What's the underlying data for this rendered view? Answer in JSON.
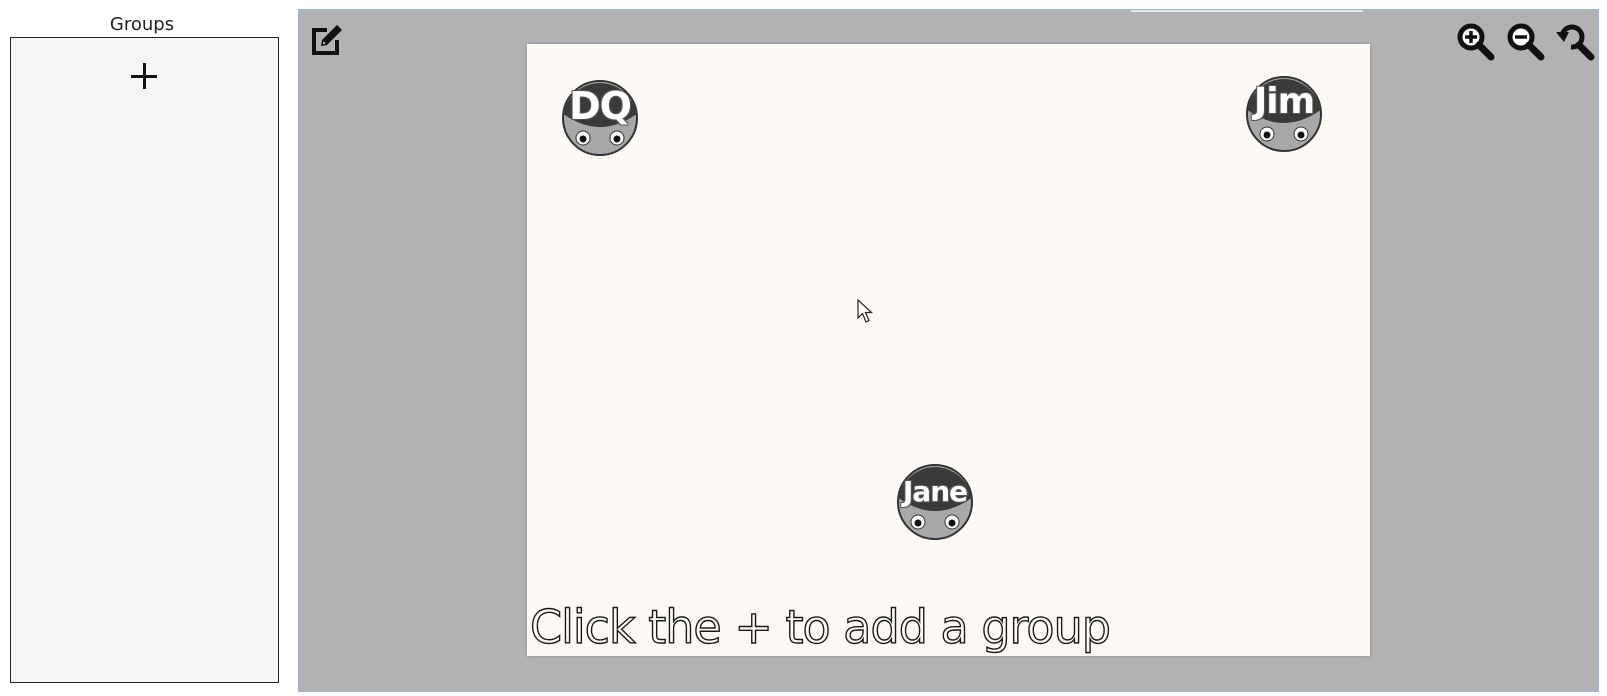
{
  "sidebar": {
    "title": "Groups",
    "add_button_icon": "plus-icon"
  },
  "toolbar": {
    "edit_icon": "edit-icon",
    "zoom_in_icon": "zoom-in-icon",
    "zoom_out_icon": "zoom-out-icon",
    "zoom_reset_icon": "zoom-reset-icon"
  },
  "canvas": {
    "members": [
      {
        "label": "DQ"
      },
      {
        "label": "Jim"
      },
      {
        "label": "Jane"
      }
    ],
    "hint": "Click the + to add a group"
  },
  "colors": {
    "workspace_bg": "#b2b2b2",
    "canvas_bg": "#fdfaf6",
    "panel_bg": "#f6f6f6",
    "avatar_dark": "#3a3a3a",
    "avatar_light": "#a8a8a8"
  }
}
